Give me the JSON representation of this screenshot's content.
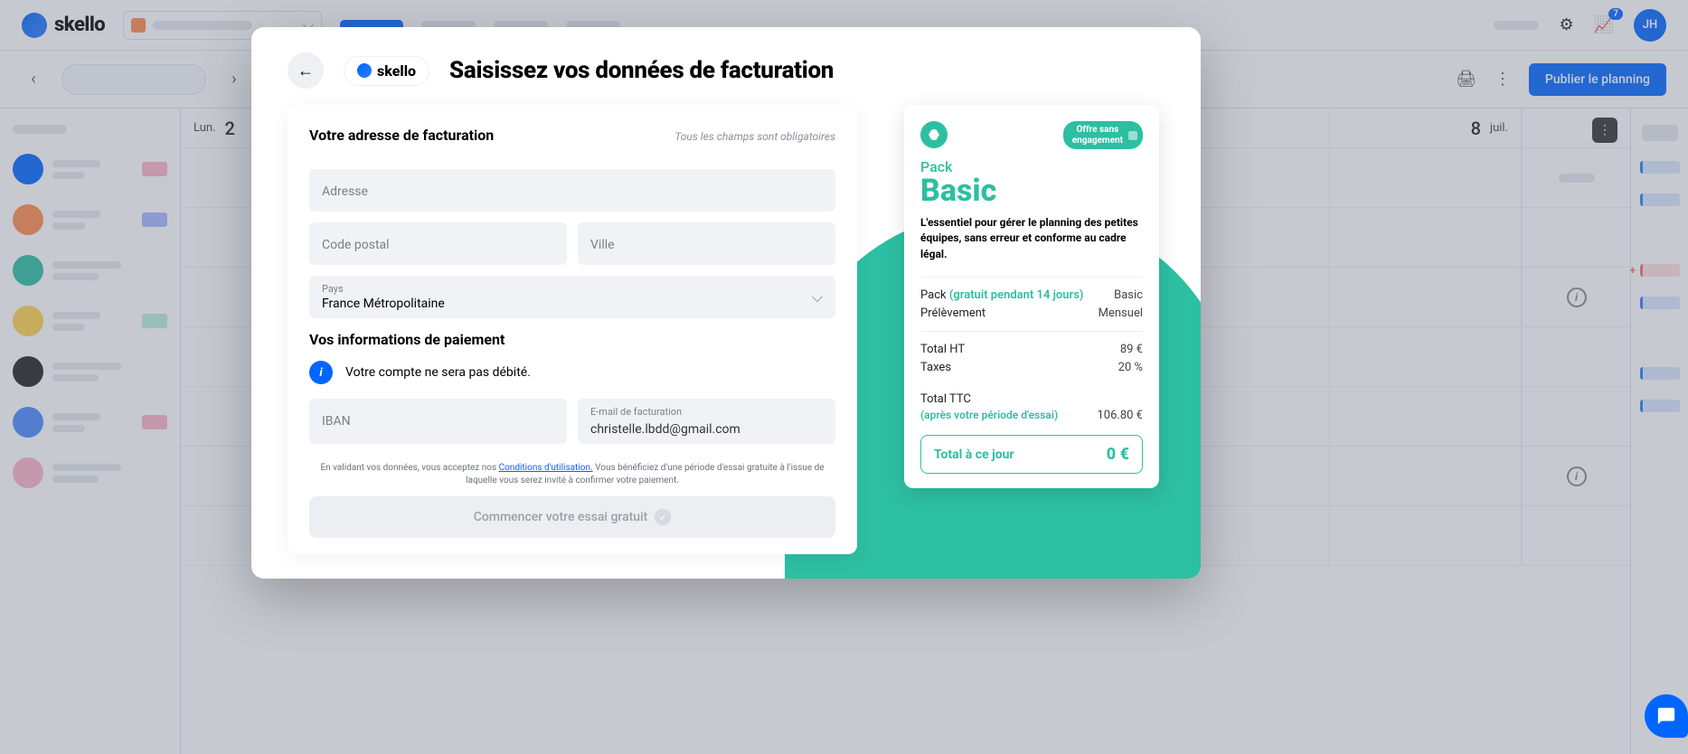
{
  "header": {
    "logo_text": "skello",
    "chart_badge": "7",
    "avatar_initials": "JH",
    "publish_label": "Publier le planning"
  },
  "days": [
    {
      "label": "Lun.",
      "num": "2"
    },
    {
      "label": "juil.",
      "num": "8"
    }
  ],
  "modal": {
    "logo_text": "skello",
    "title": "Saisissez vos données de facturation",
    "billing_section": "Votre adresse de facturation",
    "mandatory": "Tous les champs sont obligatoires",
    "address_ph": "Adresse",
    "postal_ph": "Code postal",
    "city_ph": "Ville",
    "country_label": "Pays",
    "country_value": "France Métropolitaine",
    "payment_section": "Vos informations de paiement",
    "info_text": "Votre compte ne sera pas débité.",
    "iban_ph": "IBAN",
    "email_label": "E-mail de facturation",
    "email_value": "christelle.lbdd@gmail.com",
    "legal_pre": "En validant vos données, vous acceptez nos ",
    "legal_link": "Conditions d'utilisation.",
    "legal_post": " Vous bénéficiez d'une période d'essai gratuite à l'issue de laquelle vous serez invité à confirmer votre paiement.",
    "submit_label": "Commencer votre essai gratuit"
  },
  "summary": {
    "offer_line1": "Offre sans",
    "offer_line2": "engagement",
    "pack_label": "Pack",
    "pack_name": "Basic",
    "description": "L'essentiel pour gérer le planning des petites équipes, sans erreur et conforme au cadre légal.",
    "rows": {
      "pack_lbl": "Pack",
      "pack_free": " (gratuit pendant 14 jours)",
      "pack_val": "Basic",
      "period_lbl": "Prélèvement",
      "period_val": "Mensuel",
      "ht_lbl": "Total HT",
      "ht_val": "89 €",
      "tax_lbl": "Taxes",
      "tax_val": "20 %",
      "ttc_lbl": "Total TTC",
      "after_trial": "(après votre période d'essai)",
      "ttc_val": "106.80 €"
    },
    "total_label": "Total à ce jour",
    "total_value": "0 €"
  }
}
